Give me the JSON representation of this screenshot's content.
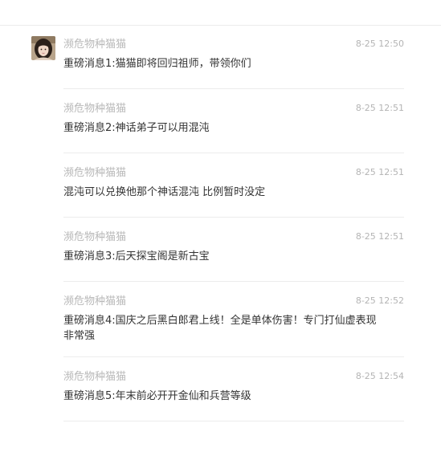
{
  "comments": [
    {
      "sender": "濒危物种猫猫",
      "time": "8-25 12:50",
      "text": "重磅消息1:猫猫即将回归祖师，带领你们"
    },
    {
      "sender": "濒危物种猫猫",
      "time": "8-25 12:51",
      "text": "重磅消息2:神话弟子可以用混沌"
    },
    {
      "sender": "濒危物种猫猫",
      "time": "8-25 12:51",
      "text": "混沌可以兑换他那个神话混沌 比例暂时没定"
    },
    {
      "sender": "濒危物种猫猫",
      "time": "8-25 12:51",
      "text": "重磅消息3:后天探宝阁是新古宝"
    },
    {
      "sender": "濒危物种猫猫",
      "time": "8-25 12:52",
      "text": "重磅消息4:国庆之后黑白郎君上线！全是单体伤害！专门打仙虚表现非常强"
    },
    {
      "sender": "濒危物种猫猫",
      "time": "8-25 12:54",
      "text": "重磅消息5:年末前必开开金仙和兵营等级"
    }
  ]
}
